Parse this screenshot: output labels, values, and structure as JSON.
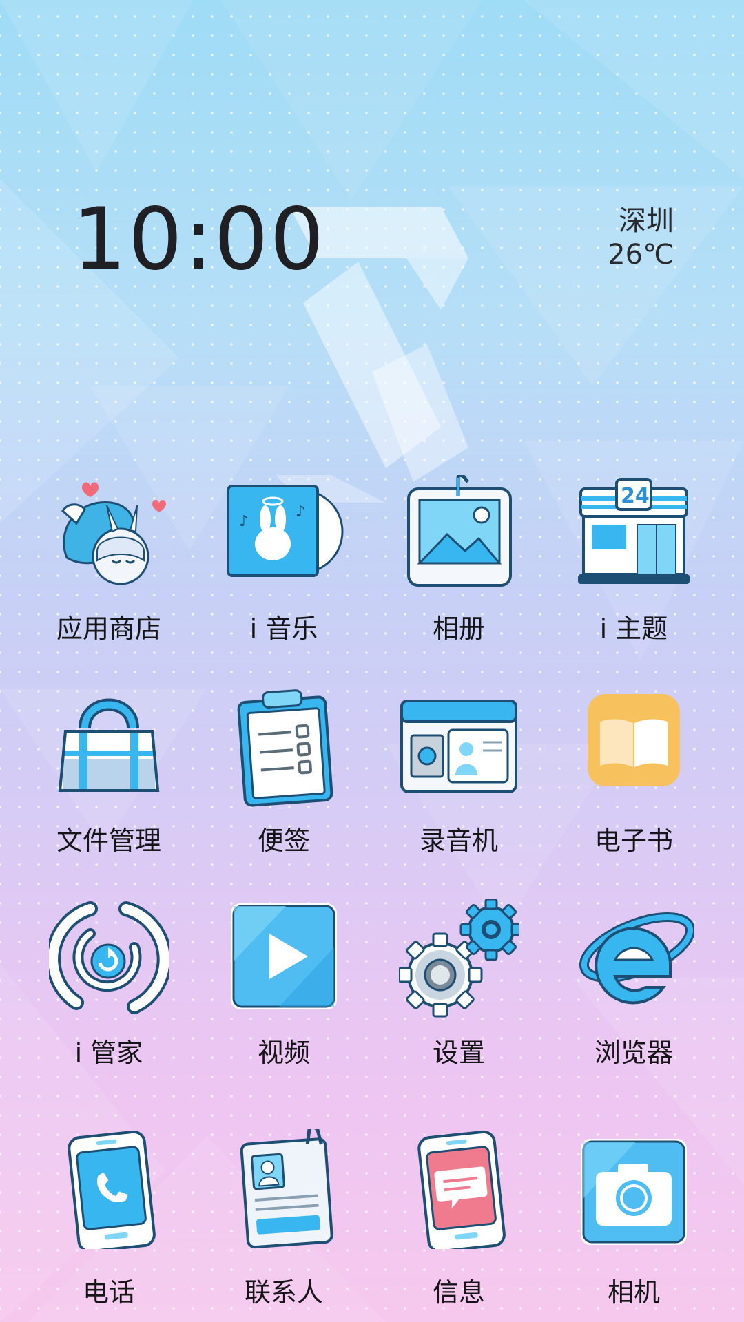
{
  "status": {
    "time": "10:00",
    "city": "深圳",
    "temperature": "26℃"
  },
  "apps": [
    {
      "label": "应用商店",
      "icon": "app-store-character-icon"
    },
    {
      "label": "i 音乐",
      "icon": "music-rabbit-cd-icon"
    },
    {
      "label": "相册",
      "icon": "photo-frame-icon"
    },
    {
      "label": "i 主题",
      "icon": "store-24-icon"
    },
    {
      "label": "文件管理",
      "icon": "bag-icon"
    },
    {
      "label": "便签",
      "icon": "clipboard-icon"
    },
    {
      "label": "录音机",
      "icon": "id-card-icon"
    },
    {
      "label": "电子书",
      "icon": "book-icon"
    },
    {
      "label": "i 管家",
      "icon": "refresh-ring-icon"
    },
    {
      "label": "视频",
      "icon": "play-icon"
    },
    {
      "label": "设置",
      "icon": "gears-icon"
    },
    {
      "label": "浏览器",
      "icon": "browser-e-icon"
    }
  ],
  "dock": [
    {
      "label": "电话",
      "icon": "phone-icon"
    },
    {
      "label": "联系人",
      "icon": "contact-card-icon"
    },
    {
      "label": "信息",
      "icon": "message-icon"
    },
    {
      "label": "相机",
      "icon": "camera-icon"
    }
  ],
  "colors": {
    "accent_blue": "#38b6f0",
    "outline": "#1d4e73",
    "book_yellow": "#f7c25e",
    "message_pink": "#f07a8e"
  }
}
